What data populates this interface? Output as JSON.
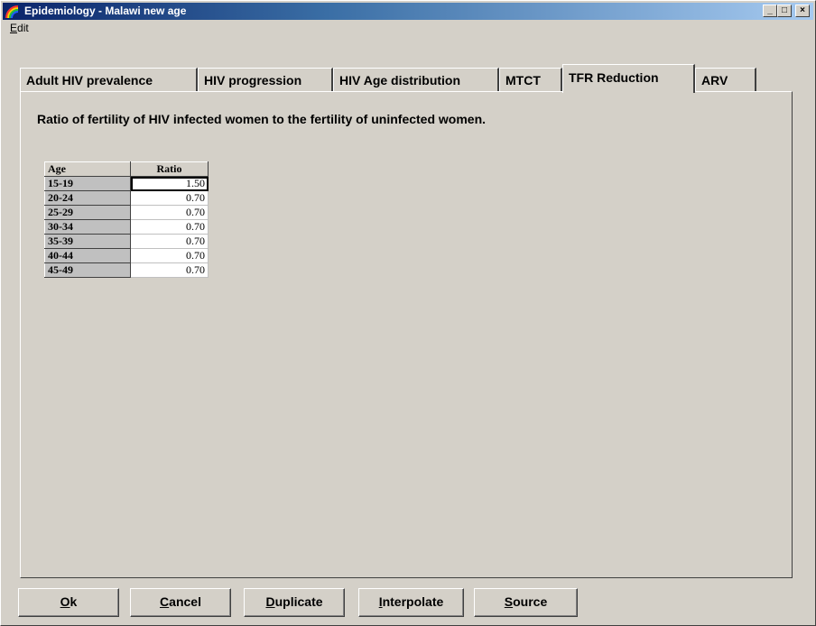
{
  "window": {
    "title": "Epidemiology - Malawi new age",
    "controls": {
      "minimize": "_",
      "maximize": "□",
      "close": "×"
    },
    "title_gradient_start": "#0a246a"
  },
  "menu": {
    "edit_accel": "E",
    "edit_rest": "dit"
  },
  "tabs": [
    {
      "label": "Adult HIV prevalence"
    },
    {
      "label": "HIV progression"
    },
    {
      "label": "HIV Age distribution"
    },
    {
      "label": "MTCT"
    },
    {
      "label": "TFR Reduction",
      "active": true
    },
    {
      "label": "ARV"
    }
  ],
  "panel": {
    "description": "Ratio of fertility of HIV infected women to the fertility of uninfected women."
  },
  "grid": {
    "headers": [
      "Age",
      "Ratio"
    ],
    "rows": [
      {
        "age": "15-19",
        "ratio": "1.50"
      },
      {
        "age": "20-24",
        "ratio": "0.70"
      },
      {
        "age": "25-29",
        "ratio": "0.70"
      },
      {
        "age": "30-34",
        "ratio": "0.70"
      },
      {
        "age": "35-39",
        "ratio": "0.70"
      },
      {
        "age": "40-44",
        "ratio": "0.70"
      },
      {
        "age": "45-49",
        "ratio": "0.70"
      }
    ],
    "selected_row": 0
  },
  "buttons": [
    {
      "accel": "O",
      "rest": "k"
    },
    {
      "accel": "C",
      "rest": "ancel"
    },
    {
      "accel": "D",
      "rest": "uplicate"
    },
    {
      "accel": "I",
      "rest": "nterpolate"
    },
    {
      "accel": "S",
      "rest": "ource"
    }
  ]
}
